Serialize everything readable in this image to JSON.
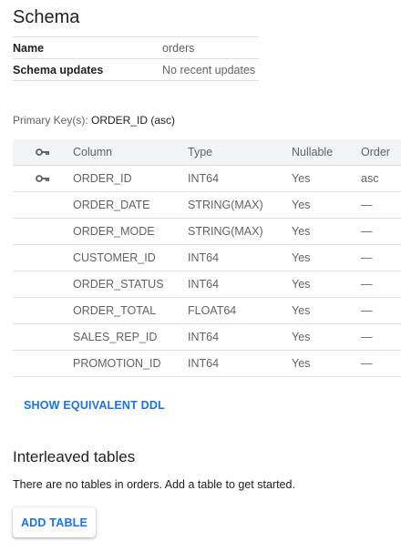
{
  "page": {
    "title": "Schema"
  },
  "info": {
    "rows": [
      {
        "key": "Name",
        "value": "orders"
      },
      {
        "key": "Schema updates",
        "value": "No recent updates"
      }
    ]
  },
  "primary_key": {
    "label": "Primary Key(s): ",
    "value": "ORDER_ID (asc)"
  },
  "columns_table": {
    "headers": {
      "column": "Column",
      "type": "Type",
      "nullable": "Nullable",
      "order": "Order"
    },
    "rows": [
      {
        "name": "ORDER_ID",
        "type": "INT64",
        "nullable": "Yes",
        "order": "asc",
        "is_key": true
      },
      {
        "name": "ORDER_DATE",
        "type": "STRING(MAX)",
        "nullable": "Yes",
        "order": "—",
        "is_key": false
      },
      {
        "name": "ORDER_MODE",
        "type": "STRING(MAX)",
        "nullable": "Yes",
        "order": "—",
        "is_key": false
      },
      {
        "name": "CUSTOMER_ID",
        "type": "INT64",
        "nullable": "Yes",
        "order": "—",
        "is_key": false
      },
      {
        "name": "ORDER_STATUS",
        "type": "INT64",
        "nullable": "Yes",
        "order": "—",
        "is_key": false
      },
      {
        "name": "ORDER_TOTAL",
        "type": "FLOAT64",
        "nullable": "Yes",
        "order": "—",
        "is_key": false
      },
      {
        "name": "SALES_REP_ID",
        "type": "INT64",
        "nullable": "Yes",
        "order": "—",
        "is_key": false
      },
      {
        "name": "PROMOTION_ID",
        "type": "INT64",
        "nullable": "Yes",
        "order": "—",
        "is_key": false
      }
    ]
  },
  "actions": {
    "show_ddl_label": "SHOW EQUIVALENT DDL",
    "add_table_label": "ADD TABLE"
  },
  "interleaved": {
    "title": "Interleaved tables",
    "empty_text": "There are no tables in orders. Add a table to get started."
  },
  "icons": {
    "key": "key-icon"
  },
  "colors": {
    "accent": "#1a73e8",
    "header_bg": "#f1f3f4",
    "divider": "#e0e0e0",
    "muted_text": "#5f6368"
  }
}
